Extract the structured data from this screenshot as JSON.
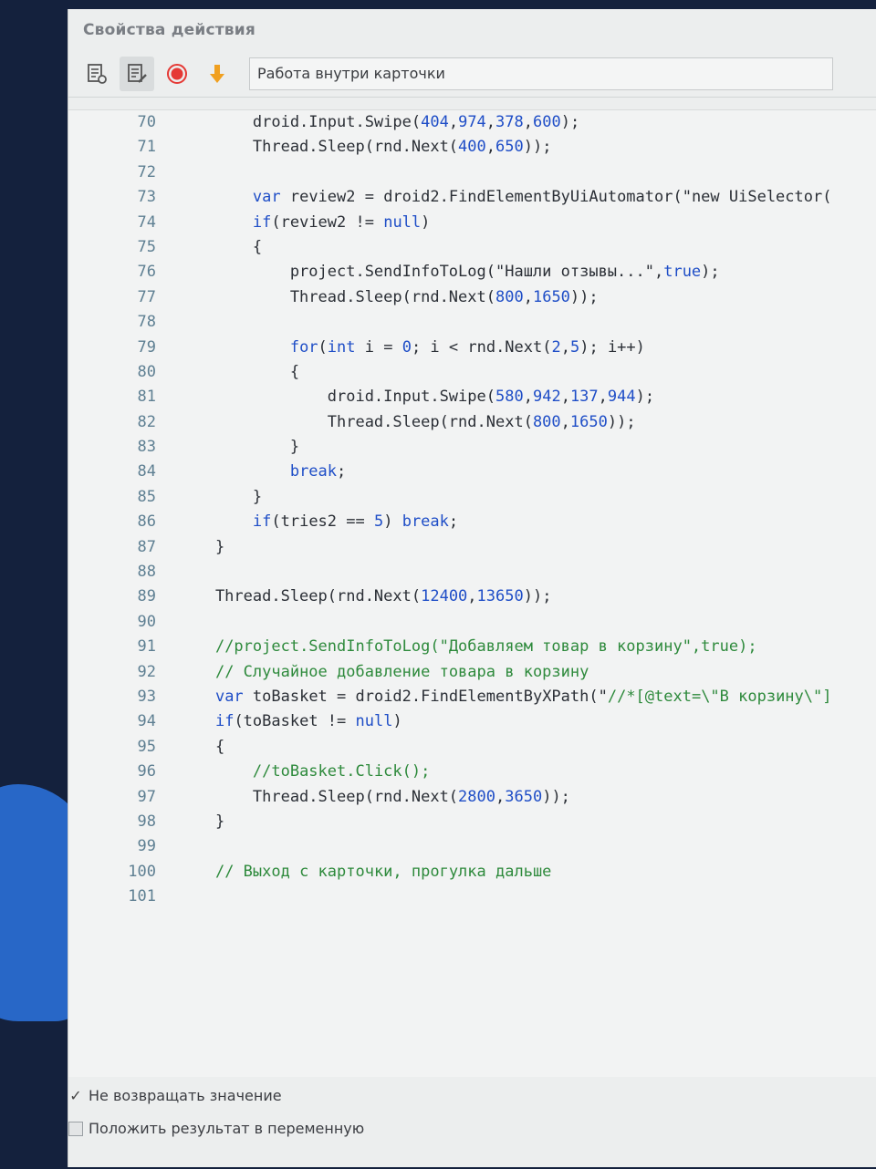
{
  "panel": {
    "title": "Свойства действия",
    "action_name": "Работа внутри карточки"
  },
  "toolbar": {
    "icons": [
      "document-settings-icon",
      "document-edit-icon",
      "record-icon",
      "arrow-down-icon"
    ]
  },
  "colors": {
    "keyword": "#1f4ec7",
    "comment": "#2e8a3c",
    "line_number": "#5e7f92",
    "record": "#e53935",
    "arrow": "#f0a020"
  },
  "code_lines": [
    {
      "n": "70",
      "t": "        droid.Input.Swipe(404,974,378,600);"
    },
    {
      "n": "71",
      "t": "        Thread.Sleep(rnd.Next(400,650));"
    },
    {
      "n": "72",
      "t": ""
    },
    {
      "n": "73",
      "t": "        var review2 = droid2.FindElementByUiAutomator(\"new UiSelector("
    },
    {
      "n": "74",
      "t": "        if(review2 != null)"
    },
    {
      "n": "75",
      "t": "        {"
    },
    {
      "n": "76",
      "t": "            project.SendInfoToLog(\"Нашли отзывы...\",true);"
    },
    {
      "n": "77",
      "t": "            Thread.Sleep(rnd.Next(800,1650));"
    },
    {
      "n": "78",
      "t": ""
    },
    {
      "n": "79",
      "t": "            for(int i = 0; i < rnd.Next(2,5); i++)"
    },
    {
      "n": "80",
      "t": "            {"
    },
    {
      "n": "81",
      "t": "                droid.Input.Swipe(580,942,137,944);"
    },
    {
      "n": "82",
      "t": "                Thread.Sleep(rnd.Next(800,1650));"
    },
    {
      "n": "83",
      "t": "            }"
    },
    {
      "n": "84",
      "t": "            break;"
    },
    {
      "n": "85",
      "t": "        }"
    },
    {
      "n": "86",
      "t": "        if(tries2 == 5) break;"
    },
    {
      "n": "87",
      "t": "    }"
    },
    {
      "n": "88",
      "t": ""
    },
    {
      "n": "89",
      "t": "    Thread.Sleep(rnd.Next(12400,13650));"
    },
    {
      "n": "90",
      "t": ""
    },
    {
      "n": "91",
      "t": "    //project.SendInfoToLog(\"Добавляем товар в корзину\",true);"
    },
    {
      "n": "92",
      "t": "    // Случайное добавление товара в корзину"
    },
    {
      "n": "93",
      "t": "    var toBasket = droid2.FindElementByXPath(\"//*[@text=\\\"В корзину\\\"]"
    },
    {
      "n": "94",
      "t": "    if(toBasket != null)"
    },
    {
      "n": "95",
      "t": "    {"
    },
    {
      "n": "96",
      "t": "        //toBasket.Click();"
    },
    {
      "n": "97",
      "t": "        Thread.Sleep(rnd.Next(2800,3650));"
    },
    {
      "n": "98",
      "t": "    }"
    },
    {
      "n": "99",
      "t": ""
    },
    {
      "n": "100",
      "t": "    // Выход с карточки, прогулка дальше"
    },
    {
      "n": "101",
      "t": ""
    }
  ],
  "footer": {
    "no_return_label": "Не возвращать значение",
    "no_return_checked": true,
    "store_result_label": "Положить результат в переменную",
    "store_result_checked": false
  }
}
